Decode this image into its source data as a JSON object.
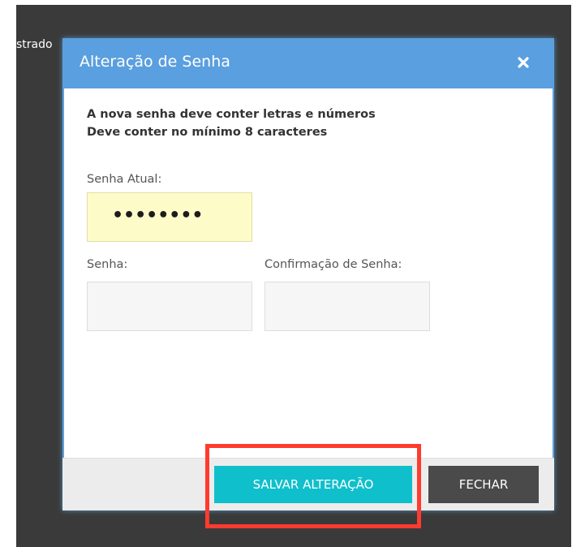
{
  "background": {
    "text": "strado"
  },
  "modal": {
    "title": "Alteração de Senha",
    "close_icon": "close-icon",
    "info_line1": "A nova senha deve conter letras e números",
    "info_line2": "Deve conter no mínimo 8 caracteres",
    "current_password": {
      "label": "Senha Atual:",
      "value_masked": "••••••••"
    },
    "new_password": {
      "label": "Senha:",
      "value": ""
    },
    "confirm_password": {
      "label": "Confirmação de Senha:",
      "value": ""
    },
    "buttons": {
      "save": "SALVAR ALTERAÇÃO",
      "close": "FECHAR"
    }
  },
  "colors": {
    "header": "#5a9fdf",
    "save_button": "#0fbfcb",
    "close_button": "#4a4a4a",
    "highlight_box": "#ff3b30",
    "current_field_bg": "#fdfbc8"
  }
}
